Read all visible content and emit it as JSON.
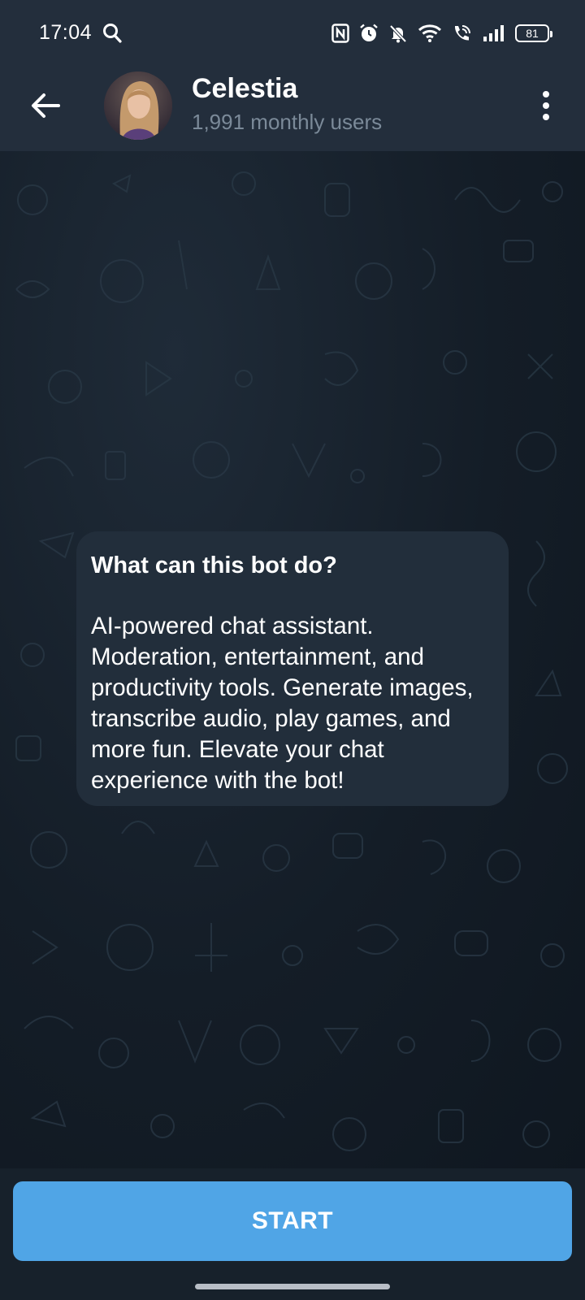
{
  "status_bar": {
    "time": "17:04",
    "battery": "81",
    "icons": [
      "search-icon",
      "nfc-icon",
      "alarm-icon",
      "mute-icon",
      "wifi-icon",
      "wifi-call-icon",
      "signal-icon",
      "battery-icon"
    ]
  },
  "header": {
    "back_icon": "arrow-left-icon",
    "title": "Celestia",
    "subtitle": "1,991 monthly users",
    "menu_icon": "more-vertical-icon"
  },
  "info": {
    "title": "What can this bot do?",
    "body": "AI-powered chat assistant. Moderation, entertainment, and productivity tools. Generate images, transcribe audio, play games, and more fun. Elevate your chat experience with the bot!"
  },
  "actions": {
    "start_label": "START"
  },
  "colors": {
    "header_bg": "#232e3c",
    "chat_bg": "#17212b",
    "bubble_bg": "#222e3b",
    "accent": "#50a5e6",
    "subtitle": "#7b8a99"
  }
}
